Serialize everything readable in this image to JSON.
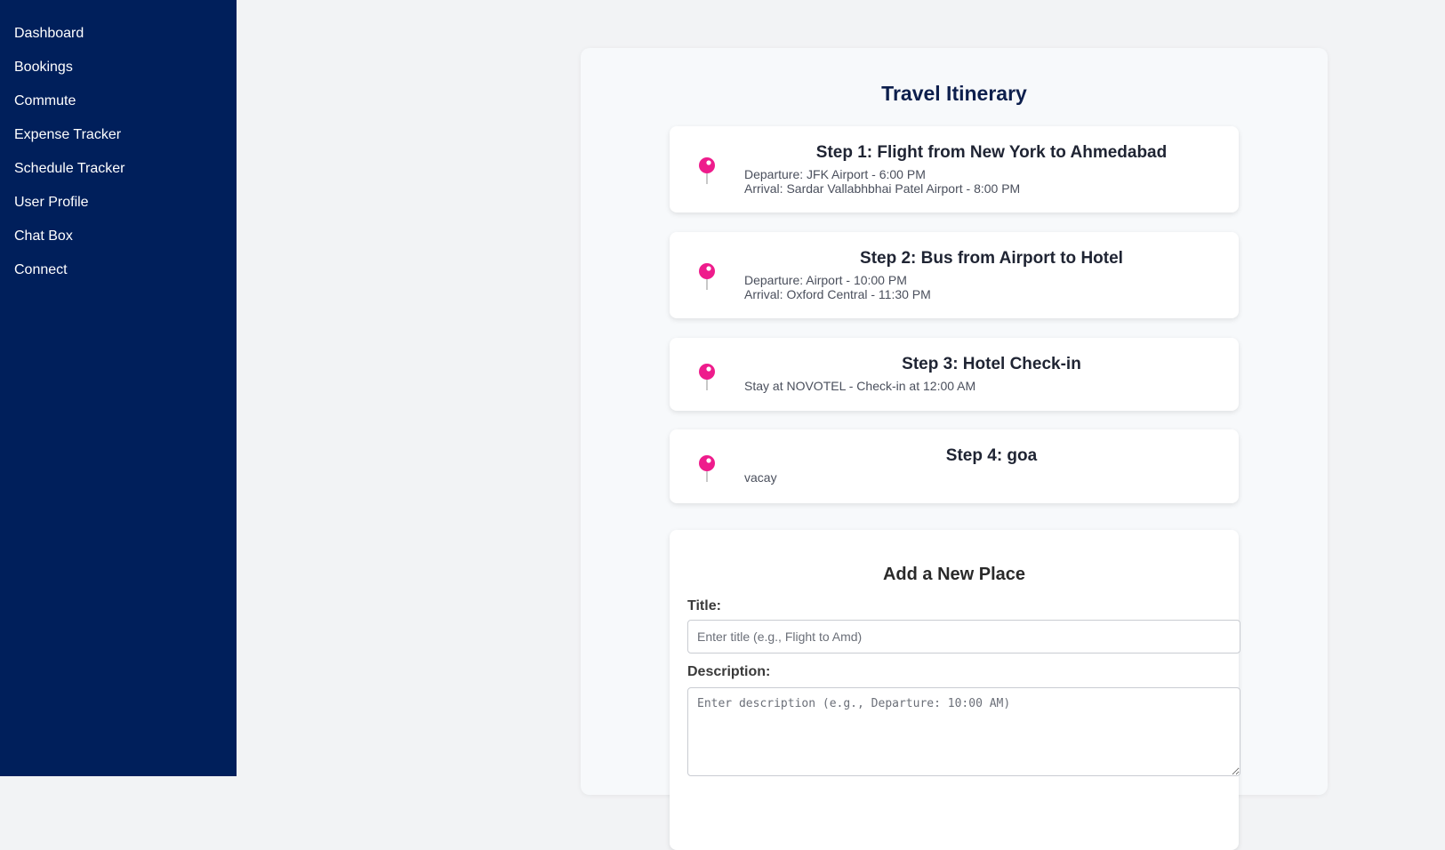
{
  "sidebar": {
    "items": [
      {
        "label": "Dashboard"
      },
      {
        "label": "Bookings"
      },
      {
        "label": "Commute"
      },
      {
        "label": "Expense Tracker"
      },
      {
        "label": "Schedule Tracker"
      },
      {
        "label": "User Profile"
      },
      {
        "label": "Chat Box"
      },
      {
        "label": "Connect"
      }
    ]
  },
  "main": {
    "title": "Travel Itinerary",
    "steps": [
      {
        "title": "Step 1: Flight from New York to Ahmedabad",
        "lines": [
          "Departure: JFK Airport - 6:00 PM",
          "Arrival: Sardar Vallabhbhai Patel Airport - 8:00 PM"
        ]
      },
      {
        "title": "Step 2: Bus from Airport to Hotel",
        "lines": [
          "Departure: Airport - 10:00 PM",
          "Arrival: Oxford Central - 11:30 PM"
        ]
      },
      {
        "title": "Step 3: Hotel Check-in",
        "lines": [
          "Stay at NOVOTEL - Check-in at 12:00 AM"
        ]
      },
      {
        "title": "Step 4: goa",
        "lines": [
          "vacay"
        ]
      }
    ],
    "form": {
      "title": "Add a New Place",
      "title_label": "Title:",
      "title_placeholder": "Enter title (e.g., Flight to Amd)",
      "description_label": "Description:",
      "description_placeholder": "Enter description (e.g., Departure: 10:00 AM)"
    }
  },
  "colors": {
    "sidebar_bg": "#001f5b",
    "pin": "#ee1c8c",
    "title": "#0d1f4d"
  },
  "icons": {
    "step": "map-pin-icon"
  }
}
